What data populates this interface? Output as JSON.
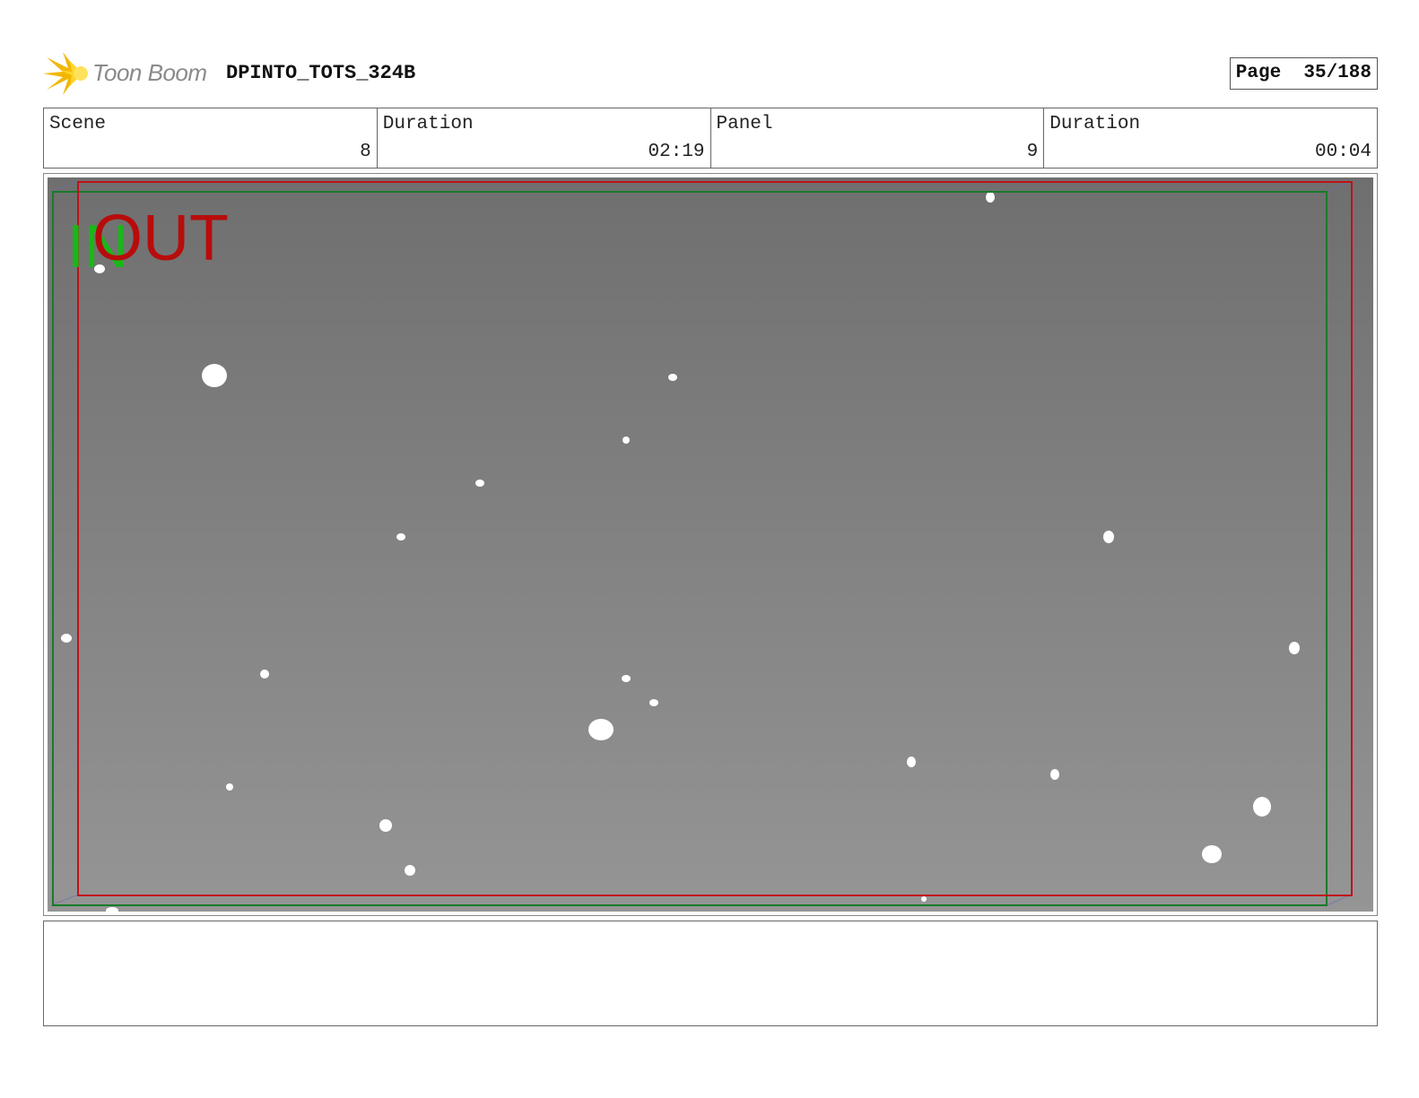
{
  "header": {
    "brand": "Toon Boom",
    "project": "DPINTO_TOTS_324B",
    "page_label": "Page",
    "page_value": "35/188",
    "page_text": "Page  35/188"
  },
  "info": [
    {
      "label": "Scene",
      "value": "8"
    },
    {
      "label": "Duration",
      "value": "02:19"
    },
    {
      "label": "Panel",
      "value": "9"
    },
    {
      "label": "Duration",
      "value": "00:04"
    }
  ],
  "panel": {
    "in_marker": "IN",
    "out_marker": "OUT",
    "colors": {
      "in_frame": "#1a7a2a",
      "out_frame": "#c0111a",
      "in_text": "#18b818",
      "out_text": "#b80c0c",
      "background_top": "#6f6f6f",
      "background_bottom": "#959595",
      "snow": "#ffffff"
    }
  },
  "notes": {
    "text": ""
  }
}
